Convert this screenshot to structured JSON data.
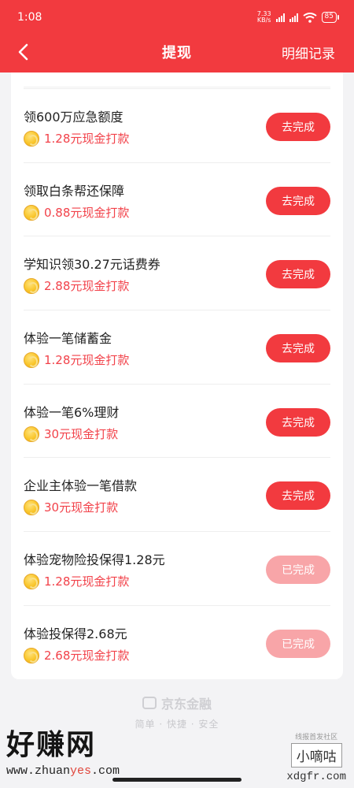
{
  "status": {
    "time": "1:08",
    "speed": "7.33\nKB/s",
    "battery": "85"
  },
  "nav": {
    "title": "提现",
    "right": "明细记录"
  },
  "tasks": [
    {
      "title": "领600万应急额度",
      "reward": "1.28元现金打款",
      "button": "去完成",
      "done": false
    },
    {
      "title": "领取白条帮还保障",
      "reward": "0.88元现金打款",
      "button": "去完成",
      "done": false
    },
    {
      "title": "学知识领30.27元话费券",
      "reward": "2.88元现金打款",
      "button": "去完成",
      "done": false
    },
    {
      "title": "体验一笔储蓄金",
      "reward": "1.28元现金打款",
      "button": "去完成",
      "done": false
    },
    {
      "title": "体验一笔6%理财",
      "reward": "30元现金打款",
      "button": "去完成",
      "done": false
    },
    {
      "title": "企业主体验一笔借款",
      "reward": "30元现金打款",
      "button": "去完成",
      "done": false
    },
    {
      "title": "体验宠物险投保得1.28元",
      "reward": "1.28元现金打款",
      "button": "已完成",
      "done": true
    },
    {
      "title": "体验投保得2.68元",
      "reward": "2.68元现金打款",
      "button": "已完成",
      "done": true
    }
  ],
  "footer": {
    "brand": "京东金融",
    "slogan": "简单 · 快捷 · 安全"
  },
  "watermark": {
    "left_big": "好赚网",
    "left_url_a": "www.zhuan",
    "left_url_b": "yes",
    "left_url_c": ".com",
    "right_small": "线报首发社区",
    "right_cn": "小嘀咕",
    "right_site": "xdgfr.com"
  },
  "colors": {
    "primary": "#f23a3f",
    "done": "#f8a5a8",
    "reward": "#f2424a"
  }
}
